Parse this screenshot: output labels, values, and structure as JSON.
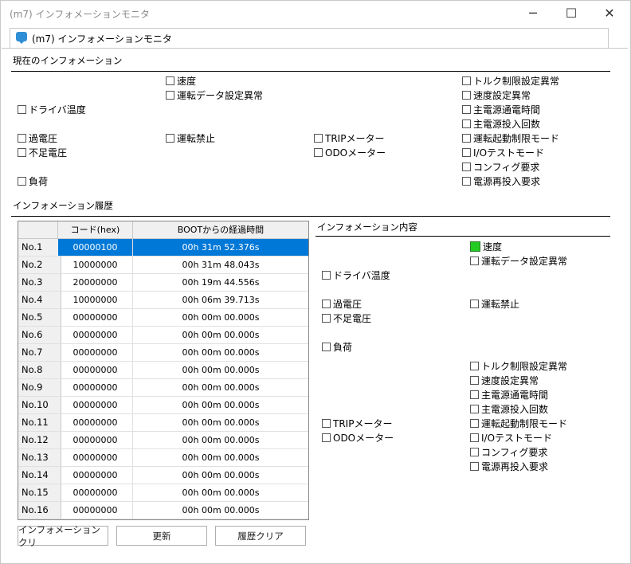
{
  "window": {
    "title": "(m7) インフォメーションモニタ",
    "minimize": "─",
    "maximize": "☐",
    "close": "✕"
  },
  "tab": {
    "label": "(m7) インフォメーションモニタ",
    "icon": "chat-bubble-icon"
  },
  "current": {
    "title": "現在のインフォメーション",
    "items": {
      "speed": "速度",
      "op_data_error": "運転データ設定異常",
      "driver_temp": "ドライバ温度",
      "overvoltage": "過電圧",
      "undervoltage": "不足電圧",
      "op_prohibit": "運転禁止",
      "trip_meter": "TRIPメーター",
      "odo_meter": "ODOメーター",
      "load": "負荷",
      "torque_limit_error": "トルク制限設定異常",
      "speed_setting_error": "速度設定異常",
      "main_power_time": "主電源通電時間",
      "main_power_count": "主電源投入回数",
      "start_limit_mode": "運転起動制限モード",
      "io_test_mode": "I/Oテストモード",
      "config_request": "コンフィグ要求",
      "power_recycle_request": "電源再投入要求"
    }
  },
  "history": {
    "title": "インフォメーション履歴",
    "columns": [
      "",
      "コード(hex)",
      "BOOTからの経過時間"
    ],
    "rows": [
      {
        "no": "No.1",
        "code": "00000100",
        "time": "00h 31m 52.376s"
      },
      {
        "no": "No.2",
        "code": "10000000",
        "time": "00h 31m 48.043s"
      },
      {
        "no": "No.3",
        "code": "20000000",
        "time": "00h 19m 44.556s"
      },
      {
        "no": "No.4",
        "code": "10000000",
        "time": "00h 06m 39.713s"
      },
      {
        "no": "No.5",
        "code": "00000000",
        "time": "00h 00m 00.000s"
      },
      {
        "no": "No.6",
        "code": "00000000",
        "time": "00h 00m 00.000s"
      },
      {
        "no": "No.7",
        "code": "00000000",
        "time": "00h 00m 00.000s"
      },
      {
        "no": "No.8",
        "code": "00000000",
        "time": "00h 00m 00.000s"
      },
      {
        "no": "No.9",
        "code": "00000000",
        "time": "00h 00m 00.000s"
      },
      {
        "no": "No.10",
        "code": "00000000",
        "time": "00h 00m 00.000s"
      },
      {
        "no": "No.11",
        "code": "00000000",
        "time": "00h 00m 00.000s"
      },
      {
        "no": "No.12",
        "code": "00000000",
        "time": "00h 00m 00.000s"
      },
      {
        "no": "No.13",
        "code": "00000000",
        "time": "00h 00m 00.000s"
      },
      {
        "no": "No.14",
        "code": "00000000",
        "time": "00h 00m 00.000s"
      },
      {
        "no": "No.15",
        "code": "00000000",
        "time": "00h 00m 00.000s"
      },
      {
        "no": "No.16",
        "code": "00000000",
        "time": "00h 00m 00.000s"
      }
    ]
  },
  "detail": {
    "title": "インフォメーション内容",
    "active": [
      "speed"
    ]
  },
  "buttons": {
    "info_clear": "インフォメーションクリ",
    "refresh": "更新",
    "history_clear": "履歴クリア"
  },
  "colors": {
    "selection": "#0078d7",
    "active_indicator": "#22cc22"
  }
}
